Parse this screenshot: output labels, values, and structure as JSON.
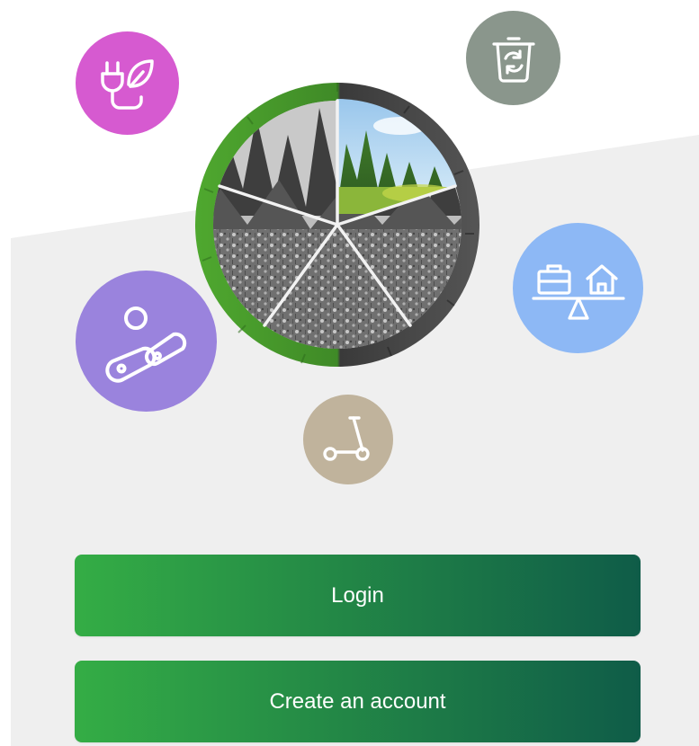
{
  "colors": {
    "background_top": "#ffffff",
    "background_bottom": "#efefef",
    "button_gradient_start": "#34ad45",
    "button_gradient_end": "#0f5c48",
    "button_text": "#ffffff",
    "energy_badge": "#d65ad0",
    "recycle_badge": "#8a968c",
    "balance_badge": "#8db8f5",
    "food_badge": "#9a83dd",
    "scooter_badge": "#c0b39c",
    "grass": "#4f9a2e"
  },
  "hero": {
    "badges": [
      {
        "icon": "plug-leaf-icon",
        "color": "#d65ad0"
      },
      {
        "icon": "recycle-bin-icon",
        "color": "#8a968c"
      },
      {
        "icon": "work-home-balance-icon",
        "color": "#8db8f5"
      },
      {
        "icon": "food-icon",
        "color": "#9a83dd"
      },
      {
        "icon": "scooter-icon",
        "color": "#c0b39c"
      }
    ],
    "wheel": {
      "segments": 5,
      "colored_segments": 1
    }
  },
  "actions": {
    "login_label": "Login",
    "create_account_label": "Create an account"
  }
}
